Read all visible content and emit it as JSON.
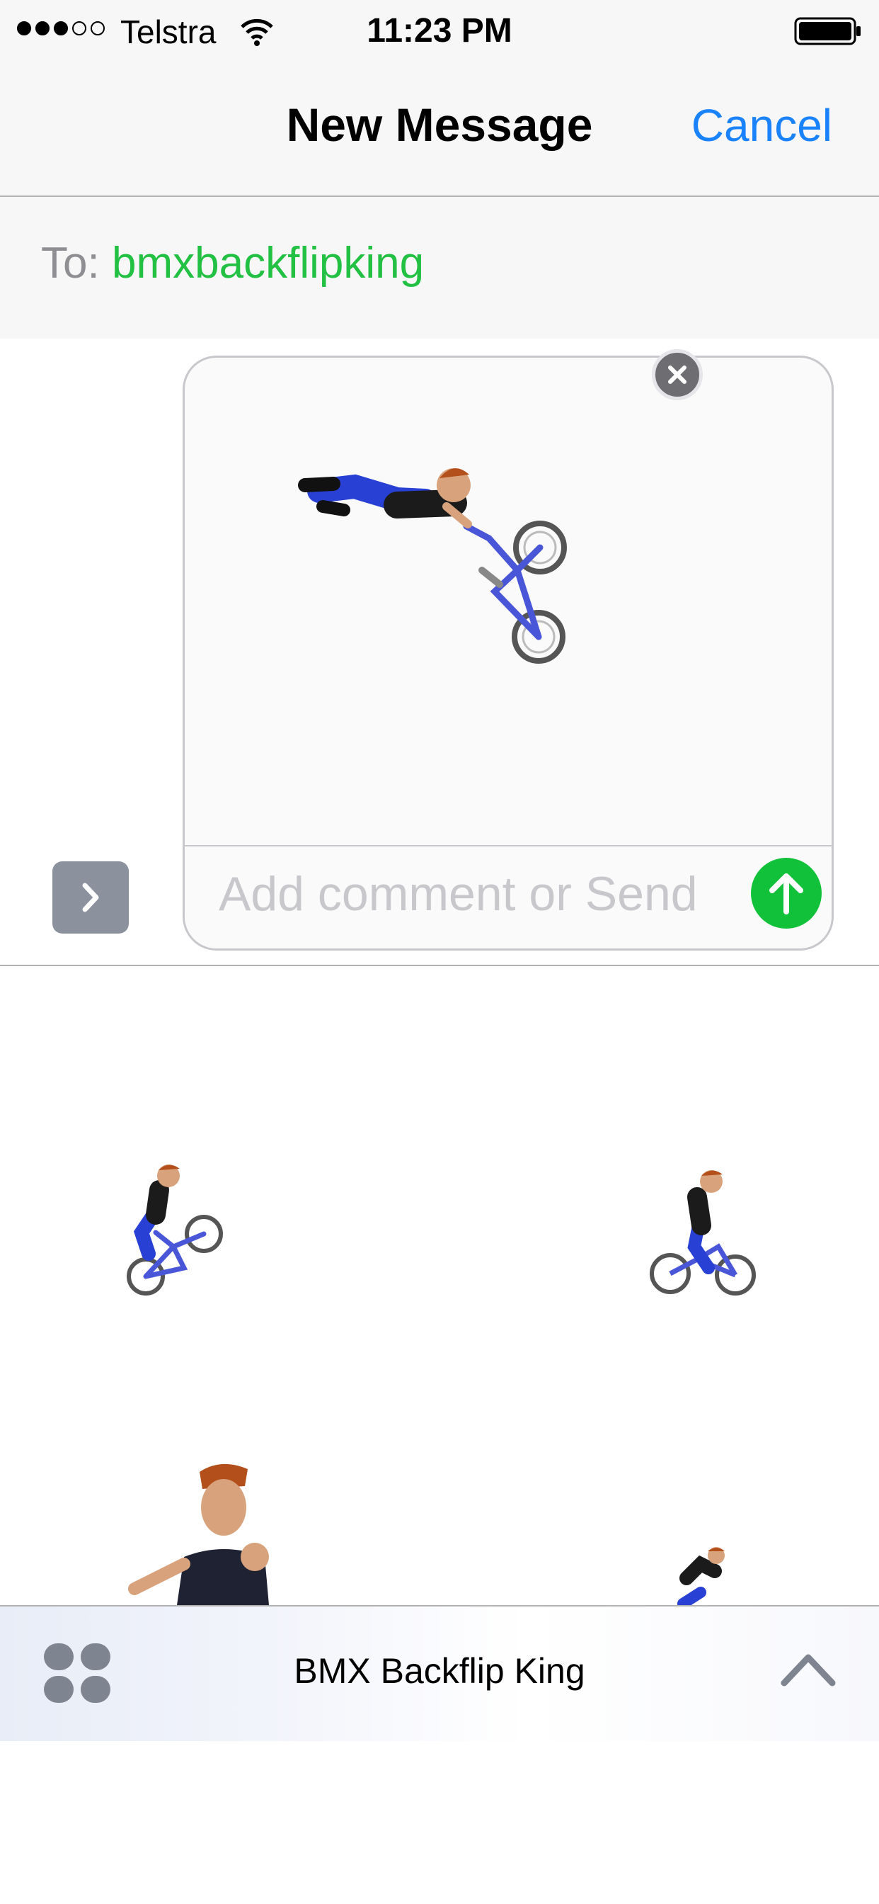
{
  "status_bar": {
    "signal_dots_filled": 3,
    "signal_dots_total": 5,
    "carrier": "Telstra",
    "time": "11:23 PM",
    "battery_level": 1.0
  },
  "nav": {
    "title": "New Message",
    "cancel_label": "Cancel"
  },
  "recipient": {
    "label": "To:",
    "value": "bmxbackflipking"
  },
  "compose": {
    "placeholder": "Add comment or Send",
    "attachment": "sticker-bmx-rider-airborne-icon"
  },
  "app_drawer": {
    "stickers": [
      "sticker-bmx-rider-wheelie-icon",
      "sticker-bmx-rider-pedaling-icon",
      "sticker-bmx-rider-portrait-icon",
      "sticker-bmx-rider-small-icon"
    ],
    "app_name": "BMX Backflip King"
  },
  "colors": {
    "accent_blue": "#1a82fb",
    "recipient_green": "#22c043",
    "send_green": "#12c13a"
  }
}
